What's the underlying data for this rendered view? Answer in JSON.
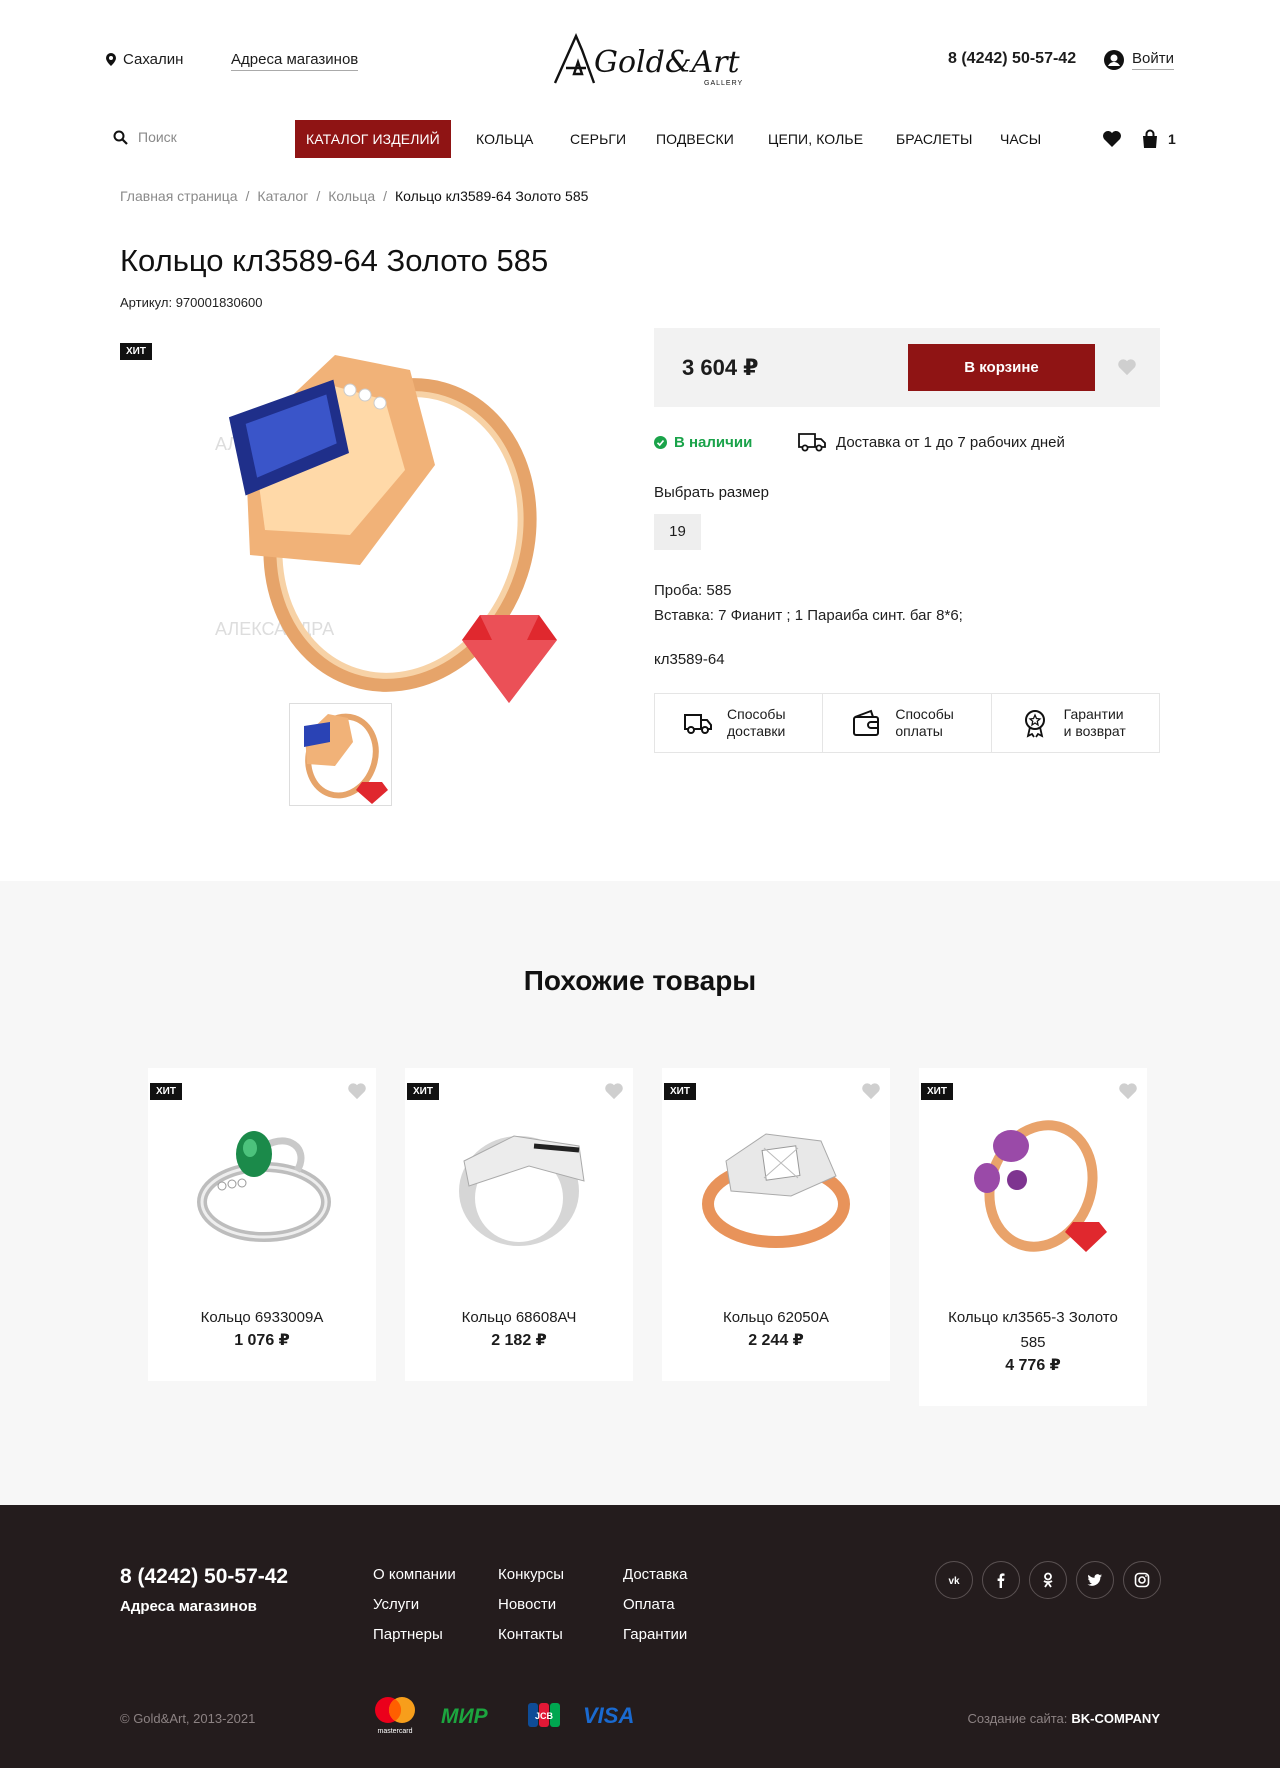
{
  "header": {
    "city": "Сахалин",
    "stores_link": "Адреса магазинов",
    "logo_text": "Gold&Art",
    "logo_sub": "GALLERY",
    "phone": "8 (4242) 50-57-42",
    "login": "Войти"
  },
  "nav": {
    "search_placeholder": "Поиск",
    "items": [
      "КАТАЛОГ ИЗДЕЛИЙ",
      "КОЛЬЦА",
      "СЕРЬГИ",
      "ПОДВЕСКИ",
      "ЦЕПИ, КОЛЬЕ",
      "БРАСЛЕТЫ",
      "ЧАСЫ"
    ],
    "cart_count": "1"
  },
  "breadcrumb": [
    "Главная страница",
    "Каталог",
    "Кольца",
    "Кольцо кл3589-64 Золото 585"
  ],
  "product": {
    "title": "Кольцо кл3589-64 Золото 585",
    "sku": "Артикул: 970001830600",
    "badge": "ХИТ",
    "price": "3 604 ₽",
    "cart_button": "В корзине",
    "stock": "В наличии",
    "delivery": "Доставка от 1 до 7 рабочих дней",
    "size_label": "Выбрать размер",
    "sizes": [
      "19"
    ],
    "probe": "Проба: 585",
    "insert": "Вставка: 7 Фианит ; 1 Параиба синт. баг 8*6;",
    "art_code": "кл3589-64",
    "info": [
      {
        "line1": "Способы",
        "line2": "доставки"
      },
      {
        "line1": "Способы",
        "line2": "оплаты"
      },
      {
        "line1": "Гарантии",
        "line2": "и возврат"
      }
    ],
    "watermark": "АЛЕКСАНДРА"
  },
  "similar": {
    "title": "Похожие товары",
    "items": [
      {
        "badge": "ХИТ",
        "name": "Кольцо 6933009А",
        "price": "1 076 ₽"
      },
      {
        "badge": "ХИТ",
        "name": "Кольцо 68608АЧ",
        "price": "2 182 ₽"
      },
      {
        "badge": "ХИТ",
        "name": "Кольцо 62050А",
        "price": "2 244 ₽"
      },
      {
        "badge": "ХИТ",
        "name": "Кольцо кл3565-3 Золото 585",
        "price": "4 776 ₽"
      }
    ]
  },
  "footer": {
    "phone": "8 (4242) 50-57-42",
    "stores": "Адреса магазинов",
    "col1": [
      "О компании",
      "Услуги",
      "Партнеры"
    ],
    "col2": [
      "Конкурсы",
      "Новости",
      "Контакты"
    ],
    "col3": [
      "Доставка",
      "Оплата",
      "Гарантии"
    ],
    "copyright": "© Gold&Art, 2013-2021",
    "credit_label": "Создание сайта:",
    "credit_name": "BK-COMPANY",
    "payments": {
      "mastercard": "mastercard",
      "mir": "МИР",
      "jcb": "JCB",
      "visa": "VISA"
    }
  },
  "colors": {
    "accent": "#8f1414",
    "footer_bg": "#241c1d",
    "stock": "#1aa34a",
    "similar_bg": "#f7f7f7"
  }
}
